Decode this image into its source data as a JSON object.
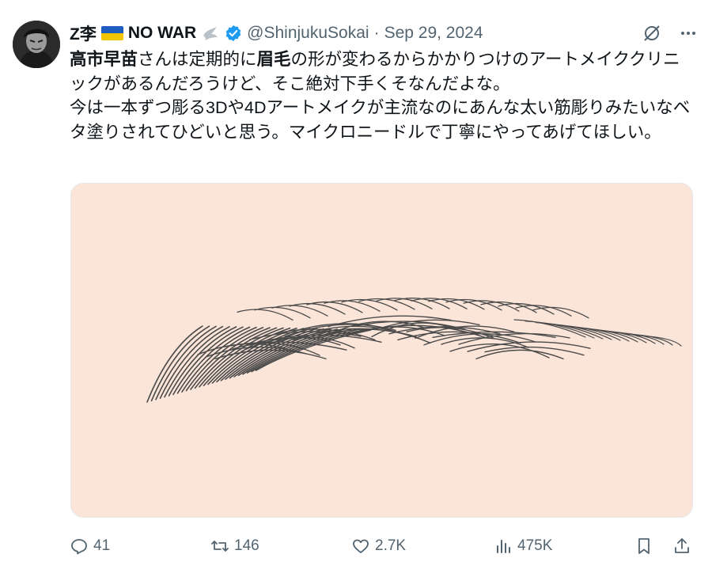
{
  "author": {
    "name": "Z李",
    "suffix": "NO WAR",
    "handle": "@ShinjukuSokai",
    "separator": "·",
    "date": "Sep 29, 2024"
  },
  "tweet": {
    "bold1": "高市早苗",
    "text1": "さんは定期的に",
    "bold2": "眉毛",
    "text2": "の形が変わるからかかりつけのアートメイククリニックがあるんだろうけど、そこ絶対下手くそなんだよな。\n今は一本ずつ彫る3Dや4Dアートメイクが主流なのにあんな太い筋彫りみたいなベタ塗りされてひどいと思う。マイクロニードルで丁寧にやってあげてほしい。"
  },
  "media": {
    "background": "#fbe5d9",
    "stroke": "#4a4a4a"
  },
  "actions": {
    "replies": "41",
    "reposts": "146",
    "likes": "2.7K",
    "views": "475K"
  },
  "icons": [
    "grok-icon",
    "more-icon",
    "reply-icon",
    "repost-icon",
    "like-icon",
    "views-icon",
    "bookmark-icon",
    "share-icon",
    "verified-icon",
    "ukraine-flag-icon",
    "dove-icon"
  ],
  "colors": {
    "verified": "#1d9bf0",
    "muted": "#536471",
    "text": "#0f1419"
  }
}
